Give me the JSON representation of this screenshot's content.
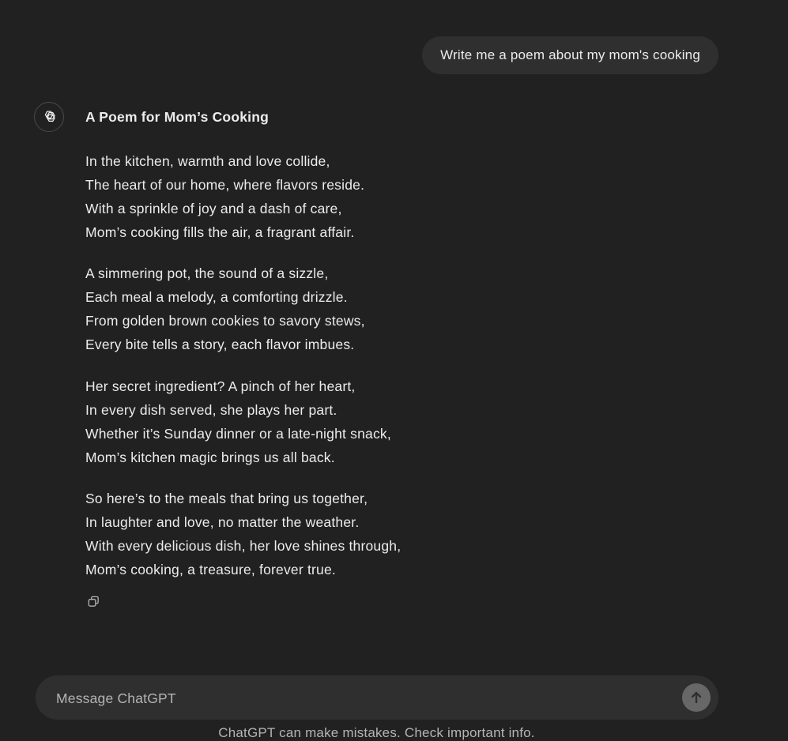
{
  "user_message": {
    "text": "Write me a poem about my mom's cooking"
  },
  "assistant": {
    "avatar_icon": "openai-logo-icon",
    "title": "A Poem for Mom’s Cooking",
    "stanzas": [
      [
        "In the kitchen, warmth and love collide,",
        "The heart of our home, where flavors reside.",
        "With a sprinkle of joy and a dash of care,",
        "Mom’s cooking fills the air, a fragrant affair."
      ],
      [
        "A simmering pot, the sound of a sizzle,",
        "Each meal a melody, a comforting drizzle.",
        "From golden brown cookies to savory stews,",
        "Every bite tells a story, each flavor imbues."
      ],
      [
        "Her secret ingredient? A pinch of her heart,",
        "In every dish served, she plays her part.",
        "Whether it’s Sunday dinner or a late-night snack,",
        "Mom’s kitchen magic brings us all back."
      ],
      [
        "So here’s to the meals that bring us together,",
        "In laughter and love, no matter the weather.",
        "With every delicious dish, her love shines through,",
        "Mom’s cooking, a treasure, forever true."
      ]
    ],
    "actions": {
      "copy_icon": "copy-icon"
    }
  },
  "composer": {
    "placeholder": "Message ChatGPT",
    "value": "",
    "send_icon": "arrow-up-icon"
  },
  "footer": {
    "disclaimer": "ChatGPT can make mistakes. Check important info."
  },
  "colors": {
    "background": "#212121",
    "bubble": "#2f2f2f",
    "text": "#ececec",
    "muted_text": "#b4b4b4",
    "send_button": "#676767"
  }
}
